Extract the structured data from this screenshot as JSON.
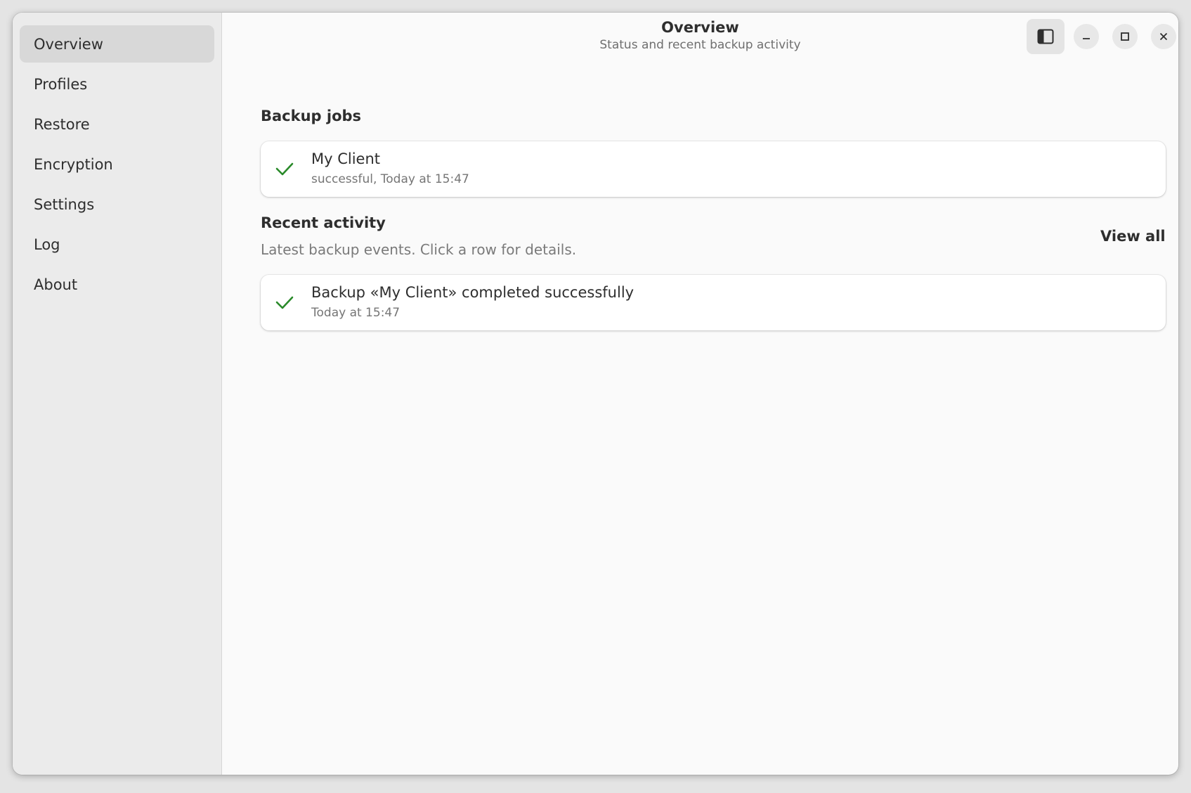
{
  "sidebar": {
    "items": [
      {
        "label": "Overview",
        "active": true
      },
      {
        "label": "Profiles"
      },
      {
        "label": "Restore"
      },
      {
        "label": "Encryption"
      },
      {
        "label": "Settings"
      },
      {
        "label": "Log"
      },
      {
        "label": "About"
      }
    ]
  },
  "header": {
    "title": "Overview",
    "subtitle": "Status and recent backup activity"
  },
  "backup_jobs": {
    "title": "Backup jobs",
    "items": [
      {
        "name": "My Client",
        "status": "successful, Today at 15:47",
        "icon": "checkmark-icon"
      }
    ]
  },
  "recent_activity": {
    "title": "Recent activity",
    "description": "Latest backup events. Click a row for details.",
    "view_all_label": "View all",
    "items": [
      {
        "title": "Backup «My Client» completed successfully",
        "time": "Today at 15:47",
        "icon": "checkmark-icon"
      }
    ]
  },
  "colors": {
    "success": "#2a8a2a",
    "sidebar_bg": "#ebebeb",
    "content_bg": "#fafafa"
  }
}
